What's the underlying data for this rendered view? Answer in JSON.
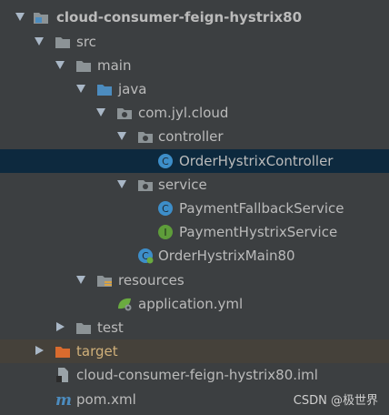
{
  "tree": {
    "project": "cloud-consumer-feign-hystrix80",
    "src": "src",
    "main": "main",
    "java": "java",
    "package": "com.jyl.cloud",
    "controller": "controller",
    "order_controller": "OrderHystrixController",
    "service": "service",
    "payment_fallback": "PaymentFallbackService",
    "payment_hystrix": "PaymentHystrixService",
    "main_class": "OrderHystrixMain80",
    "resources": "resources",
    "application_yml": "application.yml",
    "test": "test",
    "target": "target",
    "iml": "cloud-consumer-feign-hystrix80.iml",
    "pom": "pom.xml"
  },
  "icon_badges": {
    "class": "C",
    "interface": "I",
    "maven": "m"
  },
  "watermark": "CSDN @极世界",
  "colors": {
    "background": "#3c3f41",
    "selected_row": "#0d293e",
    "excluded_row": "#45413a",
    "text": "#bbbbbb",
    "folder": "#8c9396",
    "source_folder": "#4c8cbf",
    "target_folder": "#d96b2e",
    "class_icon": "#3d8ec9",
    "interface_icon": "#5e9d3a"
  }
}
